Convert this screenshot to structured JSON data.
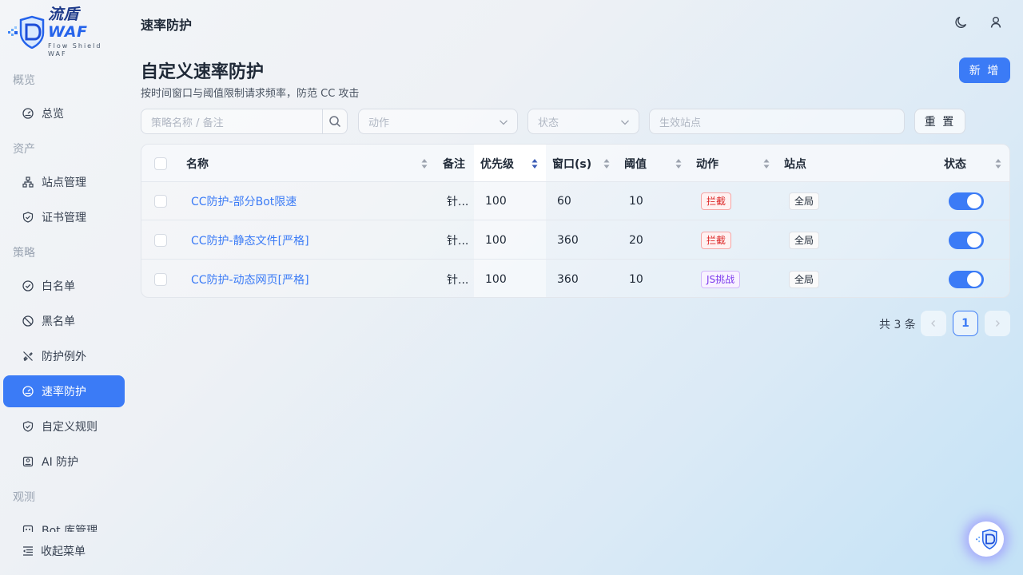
{
  "brand": {
    "name_cn": "流盾",
    "name_en": "WAF",
    "tagline": "Flow Shield WAF"
  },
  "sidebar": {
    "groups": [
      "概览",
      "资产",
      "策略",
      "观测"
    ],
    "items": [
      {
        "label": "总览",
        "icon": "dashboard-icon"
      },
      {
        "label": "站点管理",
        "icon": "sitemap-icon"
      },
      {
        "label": "证书管理",
        "icon": "shield-check-icon"
      },
      {
        "label": "白名单",
        "icon": "check-circle-icon"
      },
      {
        "label": "黑名单",
        "icon": "ban-icon"
      },
      {
        "label": "防护例外",
        "icon": "unlink-icon"
      },
      {
        "label": "速率防护",
        "icon": "gauge-icon",
        "active": true
      },
      {
        "label": "自定义规则",
        "icon": "shield-check-icon"
      },
      {
        "label": "AI 防护",
        "icon": "ai-icon"
      },
      {
        "label": "Bot 库管理",
        "icon": "bot-icon"
      }
    ],
    "collapse_label": "收起菜单"
  },
  "header": {
    "title": "速率防护",
    "icons": [
      "moon-icon",
      "user-icon"
    ]
  },
  "page": {
    "title": "自定义速率防护",
    "subtitle": "按时间窗口与阈值限制请求频率，防范 CC 攻击",
    "add_label": "新 增"
  },
  "filters": {
    "search_placeholder": "策略名称 / 备注",
    "action_placeholder": "动作",
    "status_placeholder": "状态",
    "site_placeholder": "生效站点",
    "reset_label": "重 置"
  },
  "table": {
    "columns": [
      "名称",
      "备注",
      "优先级",
      "窗口(s)",
      "阈值",
      "动作",
      "站点",
      "状态"
    ],
    "rows": [
      {
        "name": "CC防护-部分Bot限速",
        "note": "针...",
        "priority": "100",
        "window": "60",
        "threshold": "10",
        "action": "拦截",
        "action_type": "block",
        "site": "全局",
        "enabled": true
      },
      {
        "name": "CC防护-静态文件[严格]",
        "note": "针...",
        "priority": "100",
        "window": "360",
        "threshold": "20",
        "action": "拦截",
        "action_type": "block",
        "site": "全局",
        "enabled": true
      },
      {
        "name": "CC防护-动态网页[严格]",
        "note": "针...",
        "priority": "100",
        "window": "360",
        "threshold": "10",
        "action": "JS挑战",
        "action_type": "challenge",
        "site": "全局",
        "enabled": true
      }
    ]
  },
  "pagination": {
    "total_text": "共 3 条",
    "current_page": "1"
  },
  "colors": {
    "primary": "#3b7bf6",
    "danger": "#dc2626",
    "challenge": "#7c3aed"
  }
}
